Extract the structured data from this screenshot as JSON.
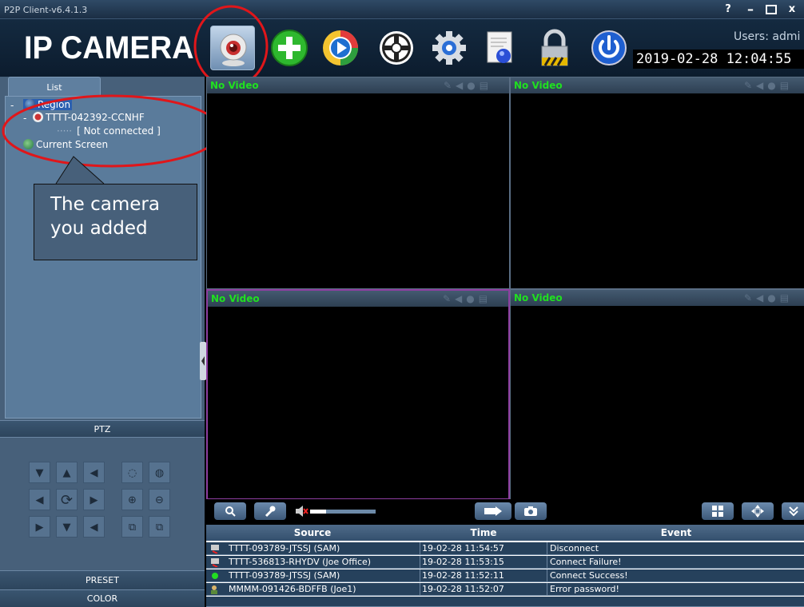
{
  "window": {
    "title": "P2P Client-v6.4.1.3",
    "help_label": "?",
    "minimize_label": "–",
    "maximize_label": "□",
    "close_label": "x"
  },
  "header": {
    "logo_text": "IP CAMERA",
    "users_text": "Users: admi",
    "clock": "2019-02-28 12:04:55",
    "toolbar_icons": [
      "camera-icon",
      "add-icon",
      "playback-icon",
      "ptz-wheel-icon",
      "settings-gear-icon",
      "log-document-icon",
      "lock-icon",
      "power-icon"
    ]
  },
  "left": {
    "list_tab": "List",
    "tree": {
      "collapse1": "-",
      "region": "Region",
      "collapse2": "-",
      "camera": "TTTT-042392-CCNHF",
      "status": "[   Not connected   ]",
      "current_screen": "Current Screen"
    },
    "callout": [
      "The camera",
      "you added"
    ],
    "ptz_label": "PTZ",
    "preset_label": "PRESET",
    "color_label": "COLOR"
  },
  "video": {
    "tiles": [
      {
        "label": "No Video"
      },
      {
        "label": "No Video"
      },
      {
        "label": "No Video"
      },
      {
        "label": "No Video"
      }
    ]
  },
  "events": {
    "headers": {
      "source": "Source",
      "time": "Time",
      "event": "Event"
    },
    "rows": [
      {
        "source": "TTTT-093789-JTSSJ (SAM)",
        "time": "19-02-28 11:54:57",
        "event": "Disconnect",
        "icon": "disconnect-icon"
      },
      {
        "source": "TTTT-536813-RHYDV (Joe Office)",
        "time": "19-02-28 11:53:15",
        "event": "Connect Failure!",
        "icon": "failure-icon"
      },
      {
        "source": "TTTT-093789-JTSSJ (SAM)",
        "time": "19-02-28 11:52:11",
        "event": "Connect Success!",
        "icon": "success-dot-icon"
      },
      {
        "source": "MMMM-091426-BDFFB (Joe1)",
        "time": "19-02-28 11:52:07",
        "event": "Error password!",
        "icon": "password-error-icon"
      }
    ]
  },
  "colors": {
    "accent_highlight": "#e0161a",
    "no_video_text": "#20e020",
    "selected_tile": "#8d3ea0",
    "panel_bg": "#47607a"
  }
}
